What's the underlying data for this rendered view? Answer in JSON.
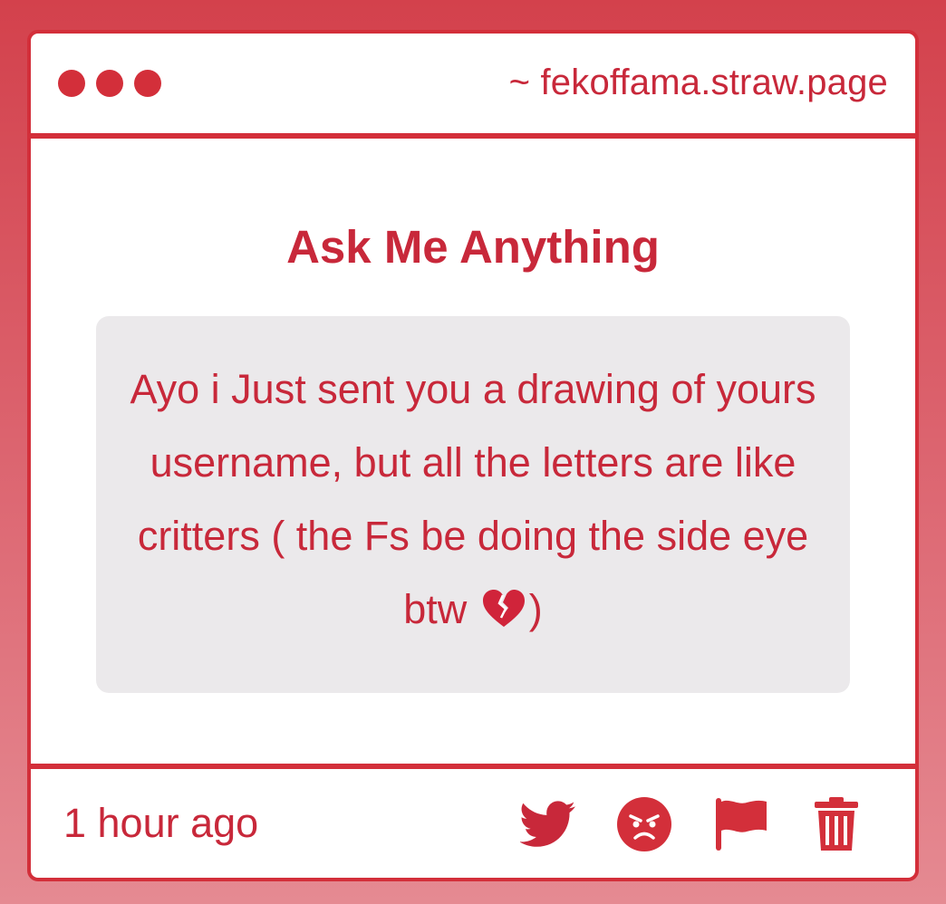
{
  "window": {
    "url": "~ fekoffama.straw.page"
  },
  "page": {
    "title": "Ask Me Anything"
  },
  "message": {
    "text": "Ayo i Just sent you a drawing of yours username, but all the letters are like critters ( the Fs be doing the side eye btw",
    "emoji": "broken-heart-icon",
    "closing": ")"
  },
  "footer": {
    "timestamp": "1 hour ago",
    "actions": [
      "twitter-icon",
      "angry-face-icon",
      "flag-icon",
      "trash-icon"
    ]
  },
  "colors": {
    "accent": "#d32f3a",
    "text": "#c8283a",
    "bubble_bg": "#ebe9eb"
  }
}
